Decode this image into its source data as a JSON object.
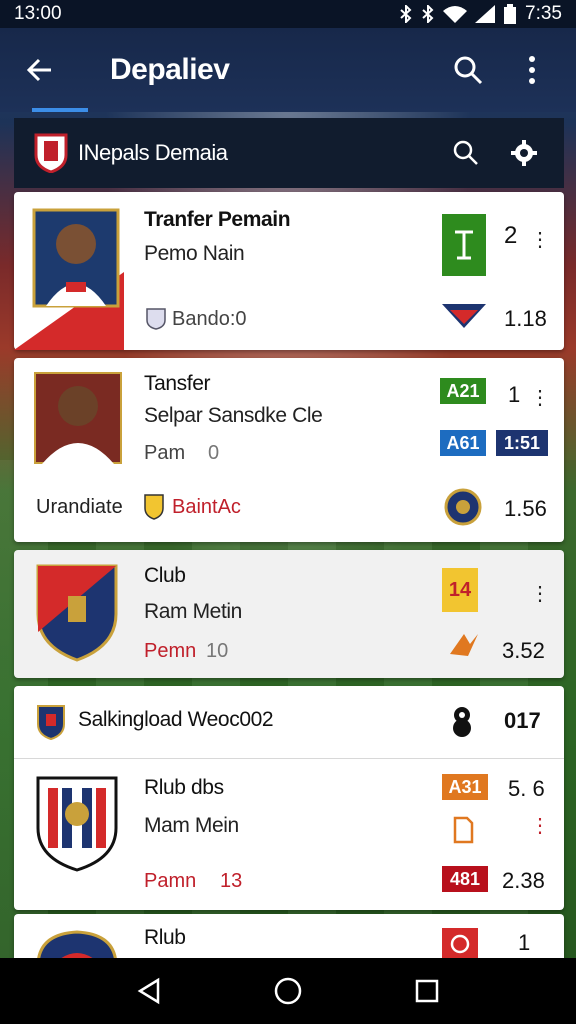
{
  "status_bar": {
    "time_left": "13:00",
    "time_right": "7:35"
  },
  "app_bar": {
    "title": "Depaliev"
  },
  "section": {
    "name": "INepals Demaia"
  },
  "cards": [
    {
      "title": "Tranfer Pemain",
      "subtitle": "Pemo Nain",
      "meta": "Bando:0",
      "count": "2",
      "score": "1.18"
    },
    {
      "title": "Tansfer",
      "subtitle": "Selpar Sansdke Cle",
      "meta_label": "Pam",
      "meta_value": "0",
      "badge_top": "A21",
      "count_top": "1",
      "badge_mid": "A61",
      "badge_mid2": "1:51",
      "bottom_left": "Urandiate",
      "bottom_club": "BaintAc",
      "score": "1.56"
    },
    {
      "title": "Club",
      "subtitle": "Ram Metin",
      "meta_label": "Pemn",
      "meta_value": "10",
      "badge": "14",
      "score": "3.52"
    },
    {
      "header_title": "Salkingload Weoc002",
      "header_value": "017",
      "title": "Rlub dbs",
      "subtitle": "Mam Mein",
      "meta_label": "Pamn",
      "meta_value": "13",
      "badge_top": "A31",
      "value_top": "5. 6",
      "badge_bottom": "481",
      "score": "2.38"
    },
    {
      "title": "Rlub",
      "count": "1"
    }
  ],
  "colors": {
    "accent_blue": "#3c8ee8",
    "red": "#c0202b",
    "green_badge": "#2e8b1e",
    "blue_badge": "#1d6cc0",
    "navy_badge": "#1d3470",
    "yellow_badge": "#f2c530",
    "orange_badge": "#e07820",
    "darkred_badge": "#b8101c"
  },
  "icons": {
    "back": "arrow-left-icon",
    "search": "search-icon",
    "more": "more-vert-icon",
    "settings": "gear-icon",
    "nav_back": "triangle-back-icon",
    "nav_home": "circle-home-icon",
    "nav_recent": "square-recent-icon"
  }
}
